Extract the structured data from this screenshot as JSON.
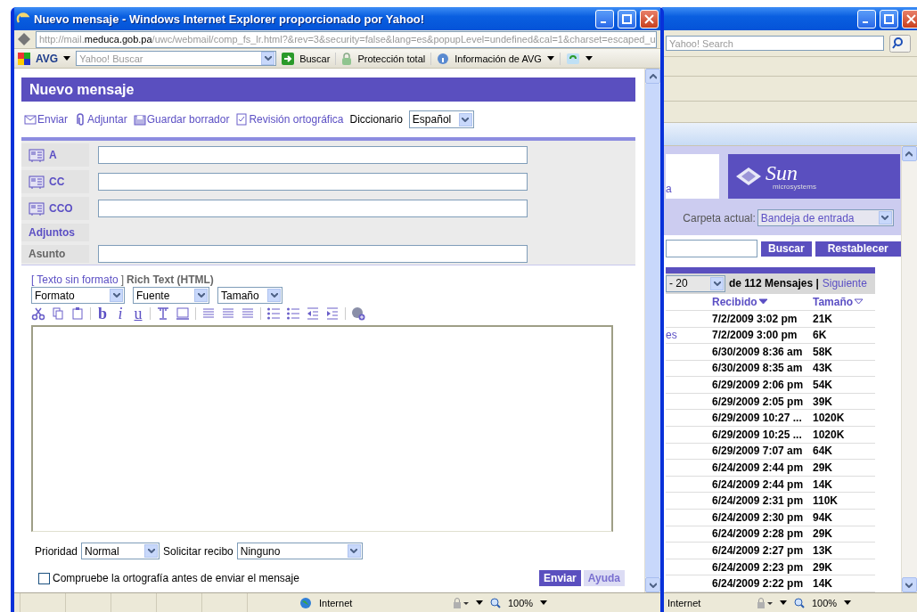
{
  "background_window": {
    "search_placeholder": "Yahoo! Search",
    "logo": {
      "name": "Sun",
      "tagline": "microsystems"
    },
    "link_fragment": "a",
    "folder_label": "Carpeta actual:",
    "folder_value": "Bandeja de entrada",
    "buttons": [
      "Buscar",
      "Restablecer"
    ],
    "page_select": "- 20",
    "page_count": "de 112 Mensajes |",
    "next_link": "Siguiente",
    "columns": [
      {
        "label": "Recibido",
        "sorted": true
      },
      {
        "label": "Tamaño",
        "sorted": false
      }
    ],
    "rows": [
      {
        "received": "7/2/2009 3:02 pm",
        "size": "21K"
      },
      {
        "column_1": "es",
        "received": "7/2/2009 3:00 pm",
        "size": "6K"
      },
      {
        "received": "6/30/2009 8:36 am",
        "size": "58K"
      },
      {
        "received": "6/30/2009 8:35 am",
        "size": "43K"
      },
      {
        "received": "6/29/2009 2:06 pm",
        "size": "54K"
      },
      {
        "received": "6/29/2009 2:05 pm",
        "size": "39K"
      },
      {
        "received": "6/29/2009 10:27 ...",
        "size": "1020K"
      },
      {
        "received": "6/29/2009 10:25 ...",
        "size": "1020K"
      },
      {
        "received": "6/29/2009 7:07 am",
        "size": "64K"
      },
      {
        "received": "6/24/2009 2:44 pm",
        "size": "29K"
      },
      {
        "received": "6/24/2009 2:44 pm",
        "size": "14K"
      },
      {
        "received": "6/24/2009 2:31 pm",
        "size": "110K"
      },
      {
        "received": "6/24/2009 2:30 pm",
        "size": "94K"
      },
      {
        "received": "6/24/2009 2:28 pm",
        "size": "29K"
      },
      {
        "received": "6/24/2009 2:27 pm",
        "size": "13K"
      },
      {
        "received": "6/24/2009 2:23 pm",
        "size": "29K"
      },
      {
        "received": "6/24/2009 2:22 pm",
        "size": "14K"
      }
    ],
    "status_bar": {
      "zone": "Internet",
      "zoom": "100%"
    }
  },
  "popup": {
    "title": "Nuevo mensaje - Windows Internet Explorer proporcionado por Yahoo!",
    "url": {
      "prefix": "http://mail.",
      "domain": "meduca.gob.pa",
      "path": "/uwc/webmail/comp_fs_lr.html?&rev=3&security=false&lang=es&popupLevel=undefined&cal=1&charset=escaped_u"
    },
    "toolbar": {
      "brand": "AVG",
      "search_placeholder": "Yahoo! Buscar",
      "search_button": "Buscar",
      "protection": "Protección total",
      "info": "Información de AVG"
    },
    "heading": "Nuevo mensaje",
    "actions": [
      {
        "kind": "send",
        "label": "Enviar"
      },
      {
        "kind": "attach",
        "label": "Adjuntar"
      },
      {
        "kind": "draft",
        "label": "Guardar borrador"
      },
      {
        "kind": "spell",
        "label": "Revisión ortográfica"
      }
    ],
    "dictionary_label": "Diccionario",
    "dictionary_value": "Español",
    "fields": [
      {
        "kind": "address",
        "label": "A"
      },
      {
        "kind": "address",
        "label": "CC"
      },
      {
        "kind": "address",
        "label": "CCO"
      },
      {
        "kind": "attachments",
        "label": "Adjuntos"
      },
      {
        "kind": "subject",
        "label": "Asunto"
      }
    ],
    "editor": {
      "mode_open": "[",
      "mode_link": "Texto sin formato",
      "mode_close": "]",
      "current_mode": "Rich Text (HTML)",
      "selects": [
        "Formato",
        "Fuente",
        "Tamaño"
      ],
      "tools": [
        {
          "kind": "cut"
        },
        {
          "kind": "copy"
        },
        {
          "kind": "paste"
        },
        {
          "kind": "sep"
        },
        {
          "kind": "text",
          "label": "b"
        },
        {
          "kind": "text",
          "label": "i"
        },
        {
          "kind": "text",
          "label": "u"
        },
        {
          "kind": "sep"
        },
        {
          "kind": "textbox"
        },
        {
          "kind": "screen"
        },
        {
          "kind": "sep"
        },
        {
          "kind": "align"
        },
        {
          "kind": "align"
        },
        {
          "kind": "align"
        },
        {
          "kind": "sep"
        },
        {
          "kind": "list"
        },
        {
          "kind": "list"
        },
        {
          "kind": "outdent"
        },
        {
          "kind": "indent"
        },
        {
          "kind": "sep"
        },
        {
          "kind": "globe"
        }
      ]
    },
    "priority_label": "Prioridad",
    "priority_value": "Normal",
    "receipt_label": "Solicitar recibo",
    "receipt_value": "Ninguno",
    "spellcheck": {
      "label": "Compruebe la ortografía antes de enviar el mensaje",
      "checked": false
    },
    "buttons": [
      {
        "label": "Enviar",
        "primary": true
      },
      {
        "label": "Ayuda",
        "primary": false
      }
    ],
    "status_bar": {
      "zone": "Internet",
      "zoom": "100%"
    }
  }
}
